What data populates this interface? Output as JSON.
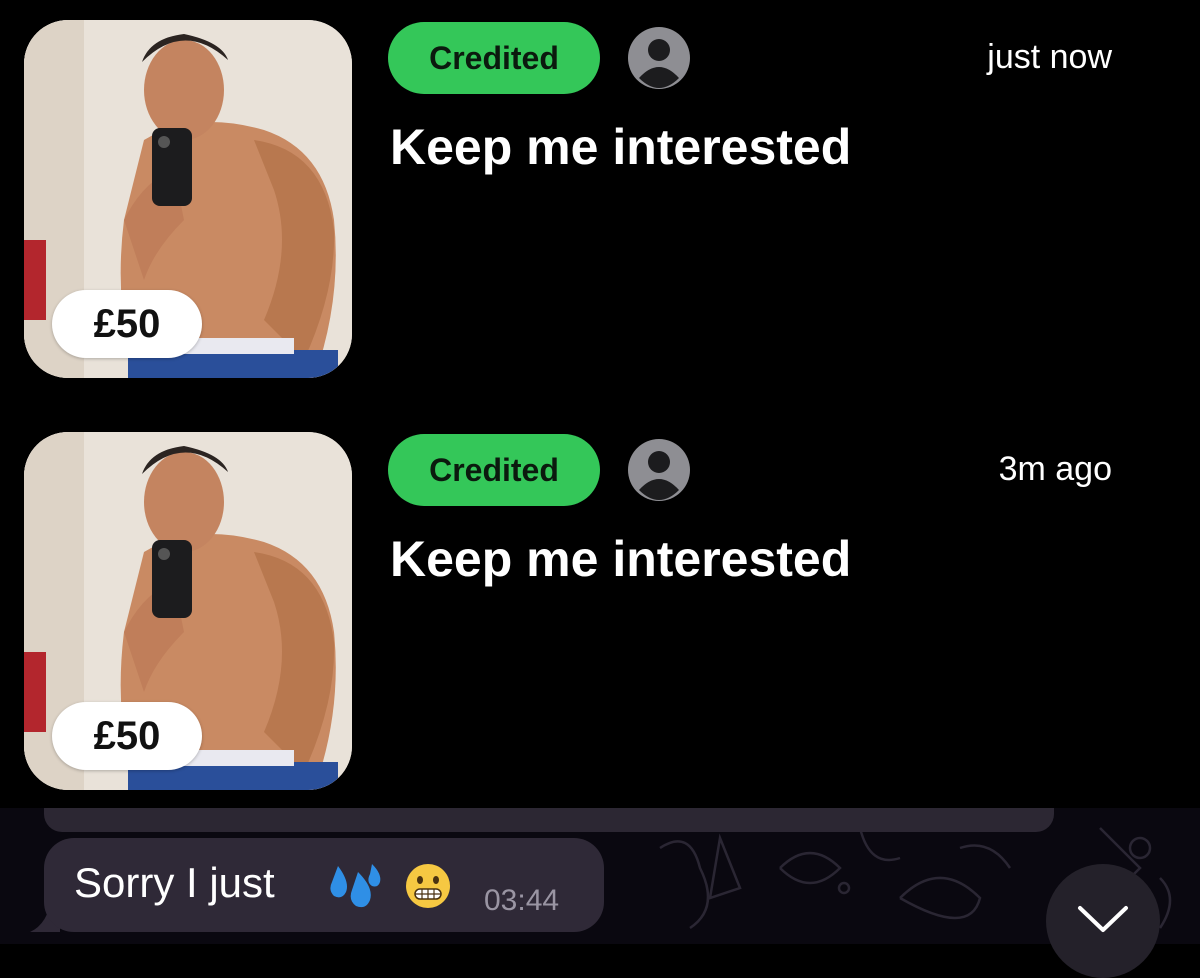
{
  "notifications": [
    {
      "price": "£50",
      "status": "Credited",
      "time": "just now",
      "title": "Keep me interested"
    },
    {
      "price": "£50",
      "status": "Credited",
      "time": "3m ago",
      "title": "Keep me interested"
    }
  ],
  "message": {
    "text": "Sorry I just",
    "emojis": [
      "sweat-droplets-emoji",
      "grimacing-face-emoji"
    ],
    "time": "03:44"
  },
  "icons": {
    "avatar": "person-avatar-icon",
    "scroll": "chevron-down-icon"
  },
  "colors": {
    "status_green": "#34c759",
    "background": "#000000",
    "bubble": "#2f2937"
  }
}
